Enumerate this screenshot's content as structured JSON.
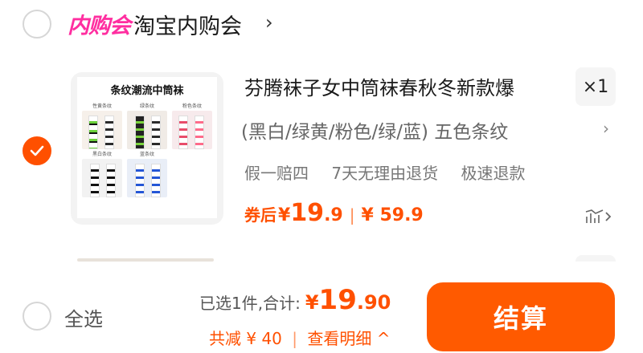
{
  "store": {
    "badge": "内购会",
    "name": "淘宝内购会",
    "chevron": "›"
  },
  "item": {
    "thumbnail": {
      "title": "条纹潮流中筒袜",
      "captions": [
        "性黄条纹",
        "绿条纹",
        "粉色条纹",
        "黑白条纹",
        "蓝条纹"
      ]
    },
    "title": "芬腾袜子女中筒袜春秋冬新款爆",
    "quantity": "×1",
    "spec": "(黑白/绿黄/粉色/绿/蓝) 五色条纹",
    "spec_chevron": "›",
    "services": [
      "假一赔四",
      "7天无理由退货",
      "极速退款"
    ],
    "price": {
      "label": "券后",
      "yen": "¥",
      "integer": "19",
      "decimal": ".9",
      "separator": "|",
      "original": "¥ 59.9"
    },
    "checked": true
  },
  "bottom": {
    "select_all": "全选",
    "selected_summary": "已选1件,合计:",
    "total_yen": "¥",
    "total_integer": "19",
    "total_decimal": ".90",
    "discount": "共减 ¥ 40",
    "separator": "|",
    "details": "查看明细 ^",
    "checkout": "结算"
  },
  "colors": {
    "accent": "#ff5000",
    "badge": "#ff2ea0"
  }
}
